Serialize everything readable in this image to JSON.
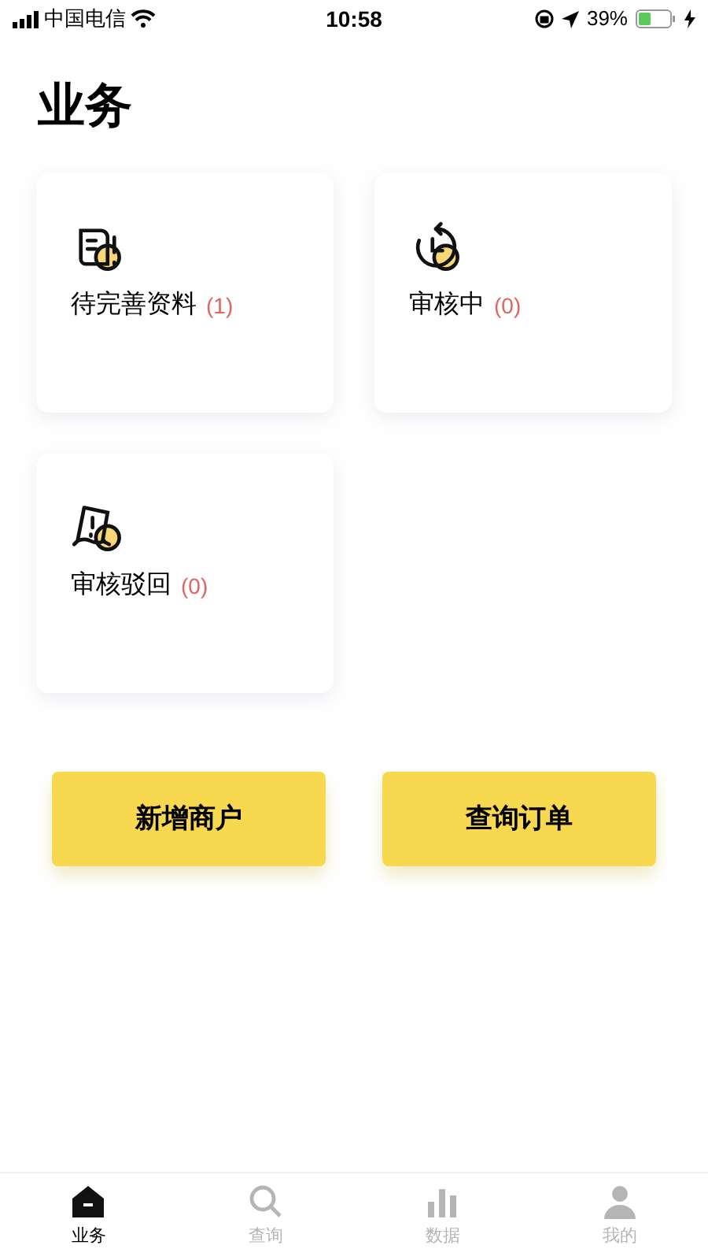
{
  "status_bar": {
    "carrier": "中国电信",
    "time": "10:58",
    "battery": "39%"
  },
  "title": "业务",
  "cards": [
    {
      "kind": "document",
      "label": "待完善资料",
      "count": "(1)"
    },
    {
      "kind": "clock",
      "label": "审核中",
      "count": "(0)"
    },
    {
      "kind": "bubble",
      "label": "审核驳回",
      "count": "(0)"
    }
  ],
  "buttons": [
    "新增商户",
    "查询订单"
  ],
  "tab_bar": [
    {
      "kind": "home",
      "label": "业务",
      "selected": true
    },
    {
      "kind": "search",
      "label": "查询",
      "selected": false
    },
    {
      "kind": "chart",
      "label": "数据",
      "selected": false
    },
    {
      "kind": "user",
      "label": "我的",
      "selected": false
    }
  ]
}
